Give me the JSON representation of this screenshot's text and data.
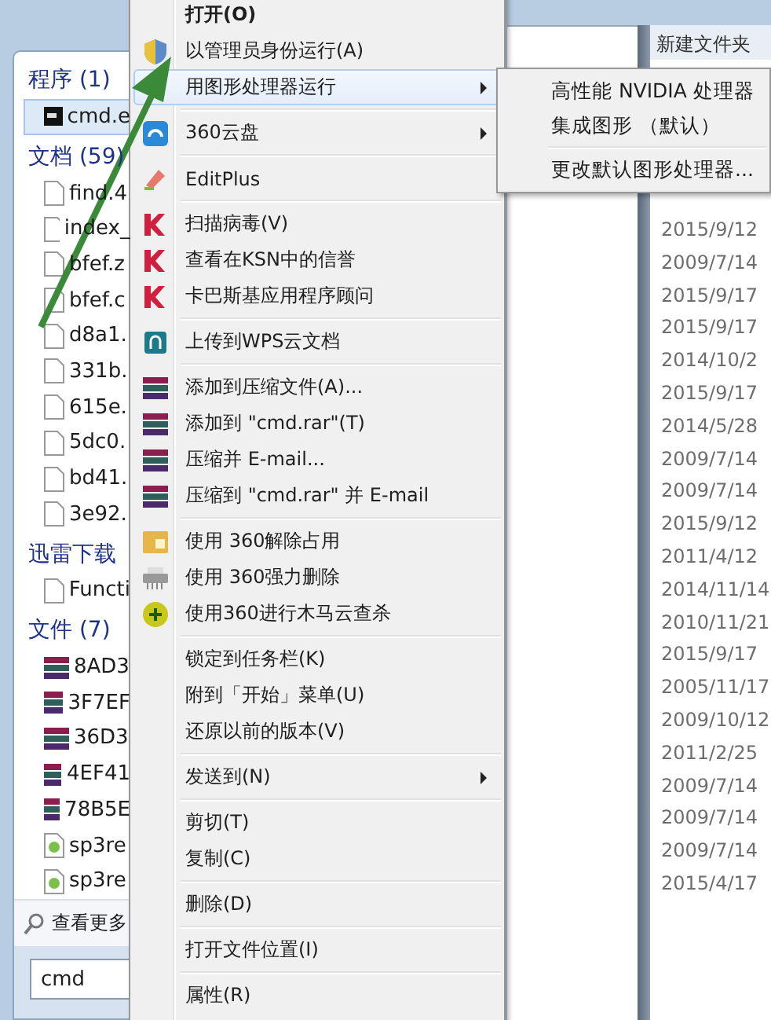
{
  "start_menu": {
    "sections": [
      {
        "heading": "程序 (1)",
        "items": [
          {
            "label": "cmd.e",
            "kind": "console",
            "selected": true
          }
        ]
      },
      {
        "heading": "文档 (59)",
        "items": [
          {
            "label": "find.4",
            "kind": "doc",
            "selected": false
          },
          {
            "label": "index_",
            "kind": "doc",
            "selected": false
          },
          {
            "label": "bfef.z",
            "kind": "doc",
            "selected": false
          },
          {
            "label": "bfef.c",
            "kind": "doc",
            "selected": false
          },
          {
            "label": "d8a1.",
            "kind": "doc",
            "selected": false
          },
          {
            "label": "331b.",
            "kind": "doc",
            "selected": false
          },
          {
            "label": "615e.",
            "kind": "doc",
            "selected": false
          },
          {
            "label": "5dc0.",
            "kind": "doc",
            "selected": false
          },
          {
            "label": "bd41.",
            "kind": "doc",
            "selected": false
          },
          {
            "label": "3e92.",
            "kind": "doc",
            "selected": false
          }
        ]
      },
      {
        "heading": "迅雷下载",
        "items": [
          {
            "label": "Functi",
            "kind": "doc",
            "selected": false
          }
        ]
      },
      {
        "heading": "文件 (7)",
        "items": [
          {
            "label": "8AD3",
            "kind": "archive",
            "selected": false
          },
          {
            "label": "3F7EF",
            "kind": "archive",
            "selected": false
          },
          {
            "label": "36D3",
            "kind": "archive",
            "selected": false
          },
          {
            "label": "4EF41",
            "kind": "archive",
            "selected": false
          },
          {
            "label": "78B5E",
            "kind": "archive",
            "selected": false
          },
          {
            "label": "sp3re",
            "kind": "web",
            "selected": false
          },
          {
            "label": "sp3re",
            "kind": "web",
            "selected": false
          }
        ]
      }
    ],
    "see_more": "查看更多",
    "search": {
      "value": "cmd"
    }
  },
  "context_menu": {
    "groups": [
      [
        {
          "label": "打开(O)",
          "kind": "none",
          "default": true,
          "selected": false,
          "has_submenu": false
        },
        {
          "label": "以管理员身份运行(A)",
          "kind": "shield",
          "default": false,
          "selected": false,
          "has_submenu": false
        },
        {
          "label": "用图形处理器运行",
          "kind": "none",
          "default": false,
          "selected": true,
          "has_submenu": true
        }
      ],
      [
        {
          "label": "360云盘",
          "kind": "cloud",
          "default": false,
          "selected": false,
          "has_submenu": true
        }
      ],
      [
        {
          "label": "EditPlus",
          "kind": "editor",
          "default": false,
          "selected": false,
          "has_submenu": false
        }
      ],
      [
        {
          "label": "扫描病毒(V)",
          "kind": "antivirus",
          "default": false,
          "selected": false,
          "has_submenu": false
        },
        {
          "label": "查看在KSN中的信誉",
          "kind": "antivirus",
          "default": false,
          "selected": false,
          "has_submenu": false
        },
        {
          "label": "卡巴斯基应用程序顾问",
          "kind": "antivirus",
          "default": false,
          "selected": false,
          "has_submenu": false
        }
      ],
      [
        {
          "label": "上传到WPS云文档",
          "kind": "upload",
          "default": false,
          "selected": false,
          "has_submenu": false
        }
      ],
      [
        {
          "label": "添加到压缩文件(A)...",
          "kind": "archive",
          "default": false,
          "selected": false,
          "has_submenu": false
        },
        {
          "label": "添加到 \"cmd.rar\"(T)",
          "kind": "archive",
          "default": false,
          "selected": false,
          "has_submenu": false
        },
        {
          "label": "压缩并 E-mail...",
          "kind": "archive",
          "default": false,
          "selected": false,
          "has_submenu": false
        },
        {
          "label": "压缩到 \"cmd.rar\" 并 E-mail",
          "kind": "archive",
          "default": false,
          "selected": false,
          "has_submenu": false
        }
      ],
      [
        {
          "label": "使用 360解除占用",
          "kind": "folder",
          "default": false,
          "selected": false,
          "has_submenu": false
        },
        {
          "label": "使用 360强力删除",
          "kind": "shredder",
          "default": false,
          "selected": false,
          "has_submenu": false
        },
        {
          "label": "使用360进行木马云查杀",
          "kind": "plus",
          "default": false,
          "selected": false,
          "has_submenu": false
        }
      ],
      [
        {
          "label": "锁定到任务栏(K)",
          "kind": "none",
          "default": false,
          "selected": false,
          "has_submenu": false
        },
        {
          "label": "附到「开始」菜单(U)",
          "kind": "none",
          "default": false,
          "selected": false,
          "has_submenu": false
        },
        {
          "label": "还原以前的版本(V)",
          "kind": "none",
          "default": false,
          "selected": false,
          "has_submenu": false
        }
      ],
      [
        {
          "label": "发送到(N)",
          "kind": "none",
          "default": false,
          "selected": false,
          "has_submenu": true
        }
      ],
      [
        {
          "label": "剪切(T)",
          "kind": "none",
          "default": false,
          "selected": false,
          "has_submenu": false
        },
        {
          "label": "复制(C)",
          "kind": "none",
          "default": false,
          "selected": false,
          "has_submenu": false
        }
      ],
      [
        {
          "label": "删除(D)",
          "kind": "none",
          "default": false,
          "selected": false,
          "has_submenu": false
        }
      ],
      [
        {
          "label": "打开文件位置(I)",
          "kind": "none",
          "default": false,
          "selected": false,
          "has_submenu": false
        }
      ],
      [
        {
          "label": "属性(R)",
          "kind": "none",
          "default": false,
          "selected": false,
          "has_submenu": false
        }
      ]
    ]
  },
  "submenu": {
    "groups": [
      [
        "高性能 NVIDIA 处理器",
        "集成图形 （默认）"
      ],
      [
        "更改默认图形处理器..."
      ]
    ]
  },
  "explorer": {
    "folder": "新建文件夹",
    "dates": [
      "2015/9/12",
      "2009/7/14",
      "2015/9/17",
      "2015/9/17",
      "2014/10/2",
      "2015/9/17",
      "2014/5/28",
      "2009/7/14",
      "2009/7/14",
      "2015/9/12",
      "2011/4/12",
      "2014/11/14",
      "2010/11/21",
      "2015/9/17",
      "2005/11/17",
      "2009/10/12",
      "2011/2/25",
      "2009/7/14",
      "2009/7/14",
      "2009/7/14",
      "2015/4/17"
    ]
  }
}
